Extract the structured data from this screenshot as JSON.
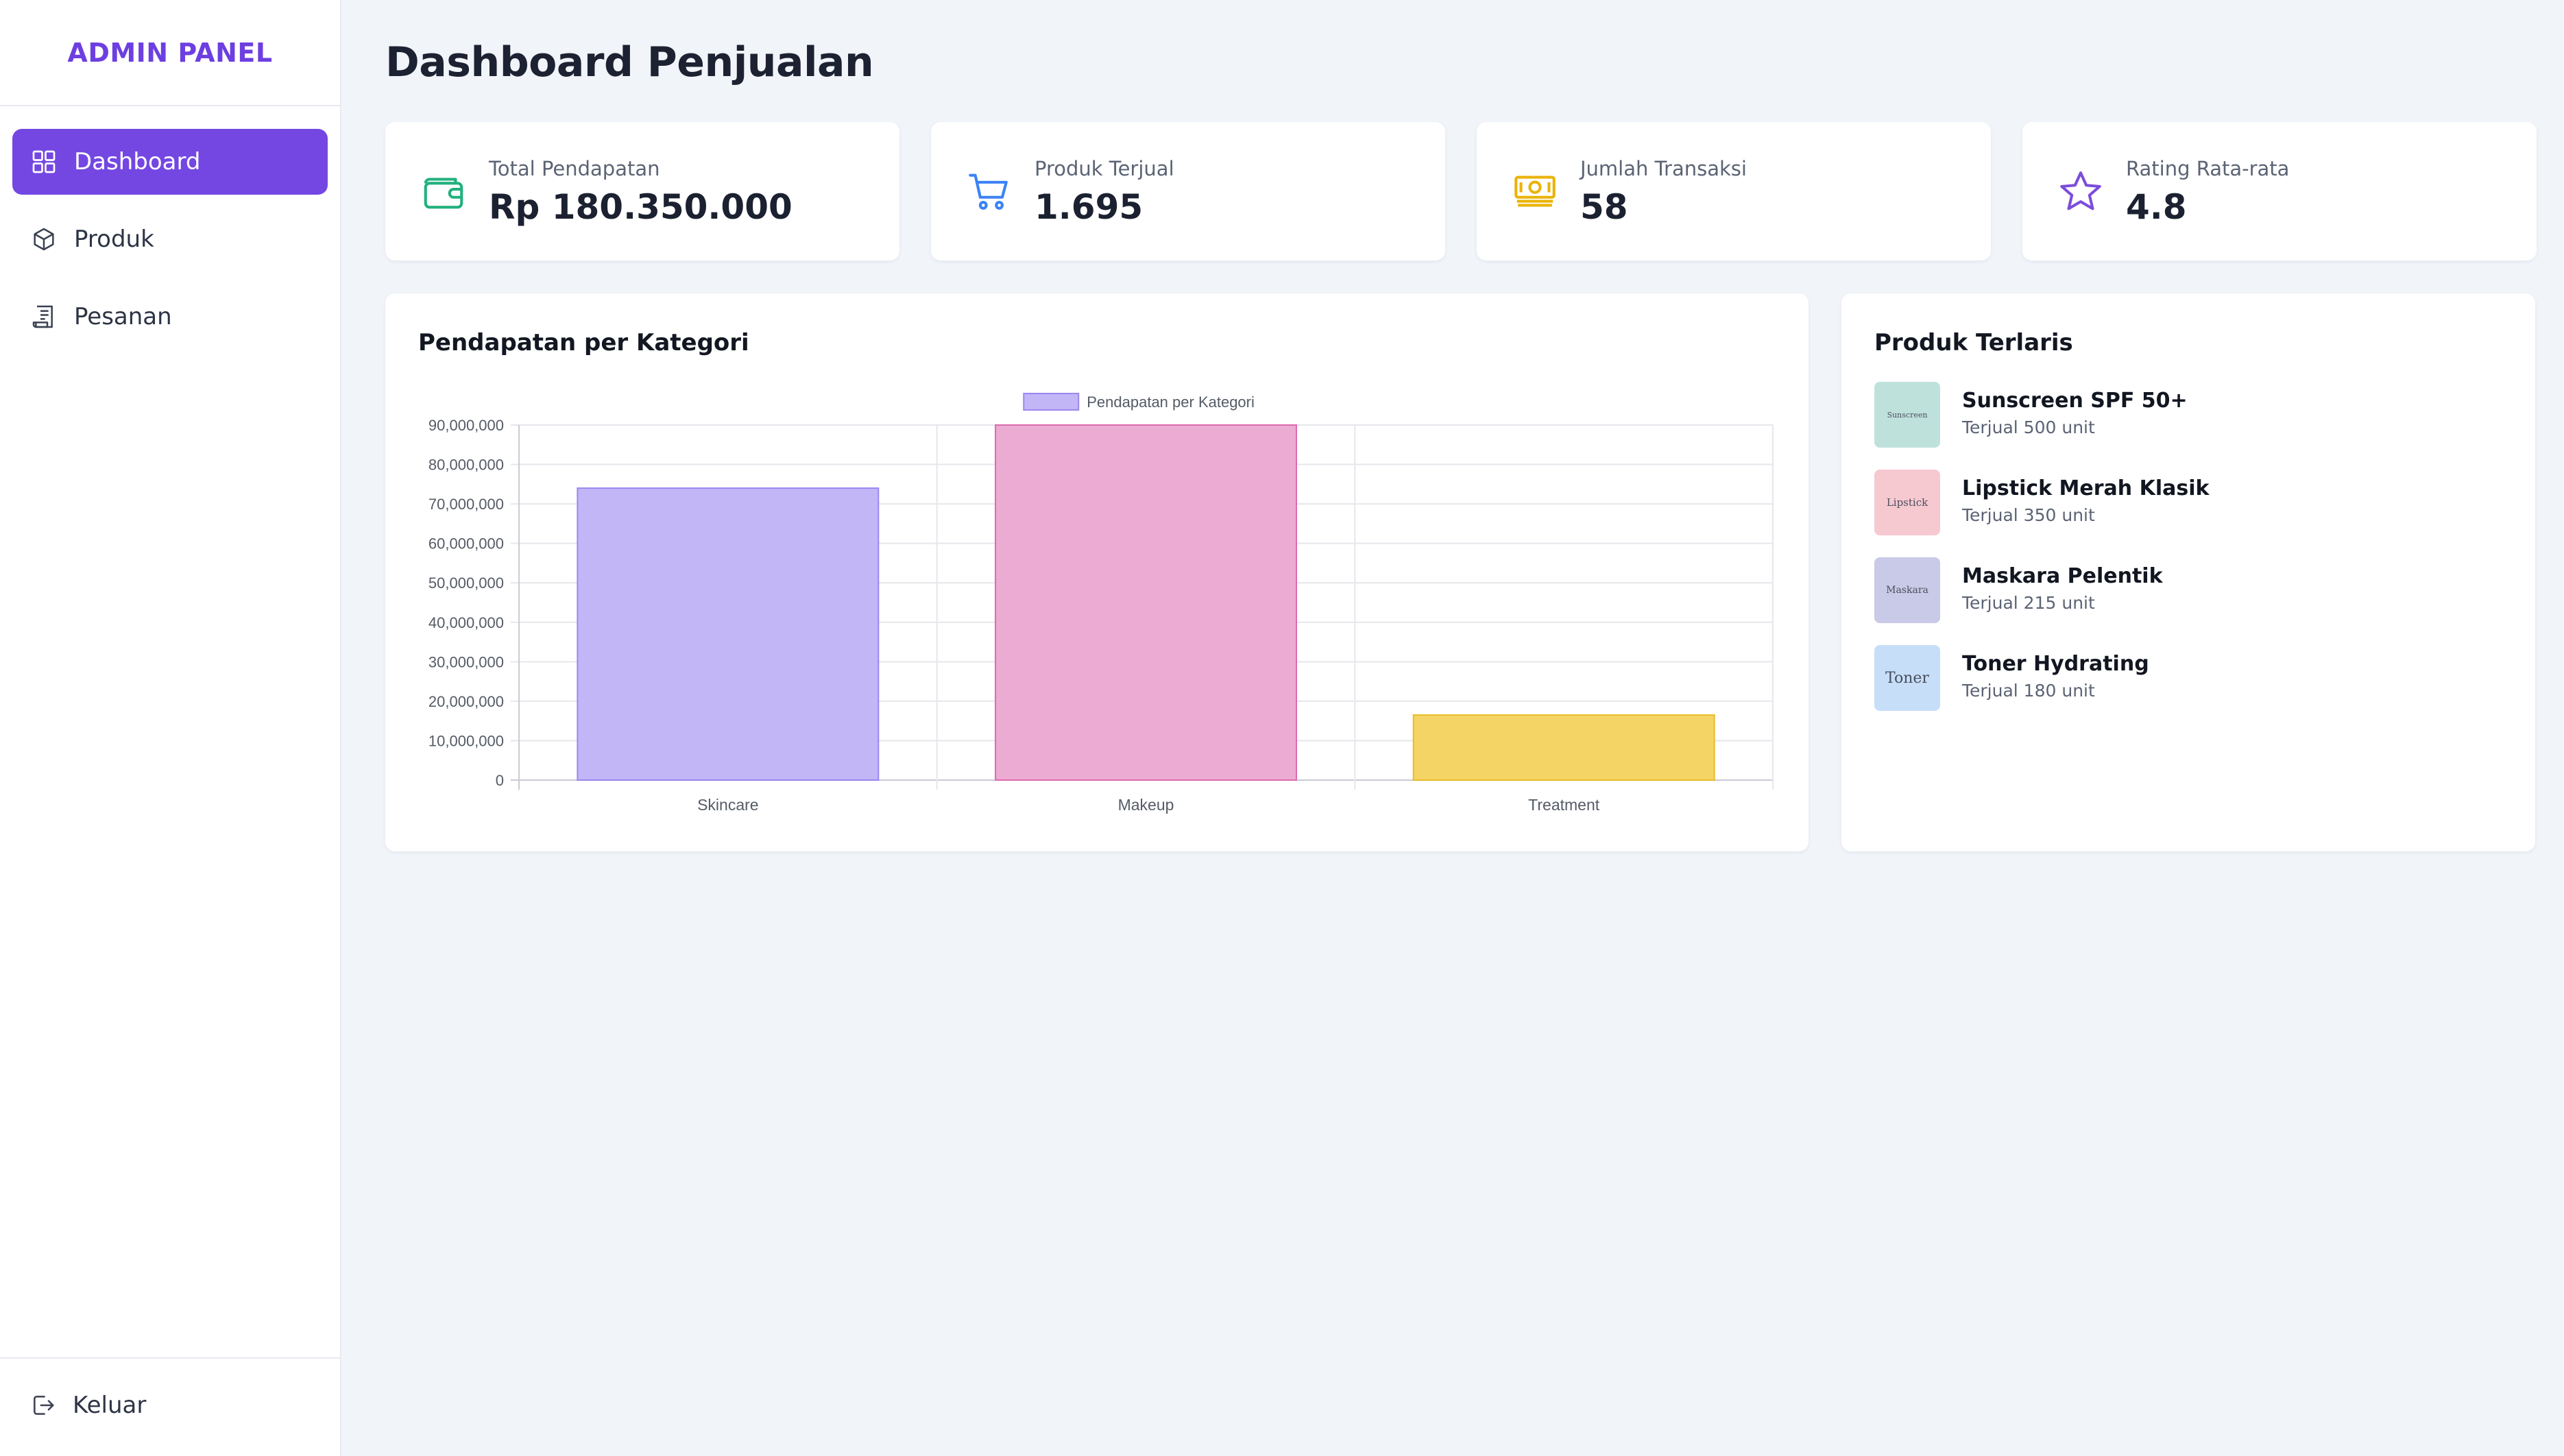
{
  "sidebar": {
    "brand": "ADMIN PANEL",
    "items": [
      {
        "label": "Dashboard",
        "icon": "grid-icon",
        "active": true
      },
      {
        "label": "Produk",
        "icon": "box-icon",
        "active": false
      },
      {
        "label": "Pesanan",
        "icon": "receipt-icon",
        "active": false
      }
    ],
    "logout_label": "Keluar"
  },
  "page_title": "Dashboard Penjualan",
  "stats": [
    {
      "label": "Total Pendapatan",
      "value": "Rp 180.350.000",
      "icon": "wallet-icon",
      "color": "#22b07d"
    },
    {
      "label": "Produk Terjual",
      "value": "1.695",
      "icon": "cart-icon",
      "color": "#3b82f6"
    },
    {
      "label": "Jumlah Transaksi",
      "value": "58",
      "icon": "money-icon",
      "color": "#eab308"
    },
    {
      "label": "Rating Rata-rata",
      "value": "4.8",
      "icon": "star-icon",
      "color": "#7c4ddb"
    }
  ],
  "chart_panel": {
    "title": "Pendapatan per Kategori"
  },
  "chart_data": {
    "type": "bar",
    "categories": [
      "Skincare",
      "Makeup",
      "Treatment"
    ],
    "series": [
      {
        "name": "Pendapatan per Kategori",
        "values": [
          74000000,
          90000000,
          16500000
        ]
      }
    ],
    "bar_colors": [
      "#c2b6f7",
      "#ecabd3",
      "#f5d466"
    ],
    "bar_borders": [
      "#9b87ee",
      "#dc6bb0",
      "#e8bb2c"
    ],
    "legend_color": "#c2b6f7",
    "legend_border": "#9b87ee",
    "ylim": [
      0,
      90000000
    ],
    "yticks": [
      "0",
      "10,000,000",
      "20,000,000",
      "30,000,000",
      "40,000,000",
      "50,000,000",
      "60,000,000",
      "70,000,000",
      "80,000,000",
      "90,000,000"
    ],
    "grid": true,
    "legend_position": "top"
  },
  "bestsellers": {
    "title": "Produk Terlaris",
    "items": [
      {
        "name": "Sunscreen SPF 50+",
        "sold": "Terjual 500 unit",
        "thumb_text": "Sunscreen",
        "thumb_color": "#bfe1dc"
      },
      {
        "name": "Lipstick Merah Klasik",
        "sold": "Terjual 350 unit",
        "thumb_text": "Lipstick",
        "thumb_color": "#f6c9d1"
      },
      {
        "name": "Maskara Pelentik",
        "sold": "Terjual 215 unit",
        "thumb_text": "Maskara",
        "thumb_color": "#c9cae7"
      },
      {
        "name": "Toner Hydrating",
        "sold": "Terjual 180 unit",
        "thumb_text": "Toner",
        "thumb_color": "#c6def8"
      }
    ]
  }
}
